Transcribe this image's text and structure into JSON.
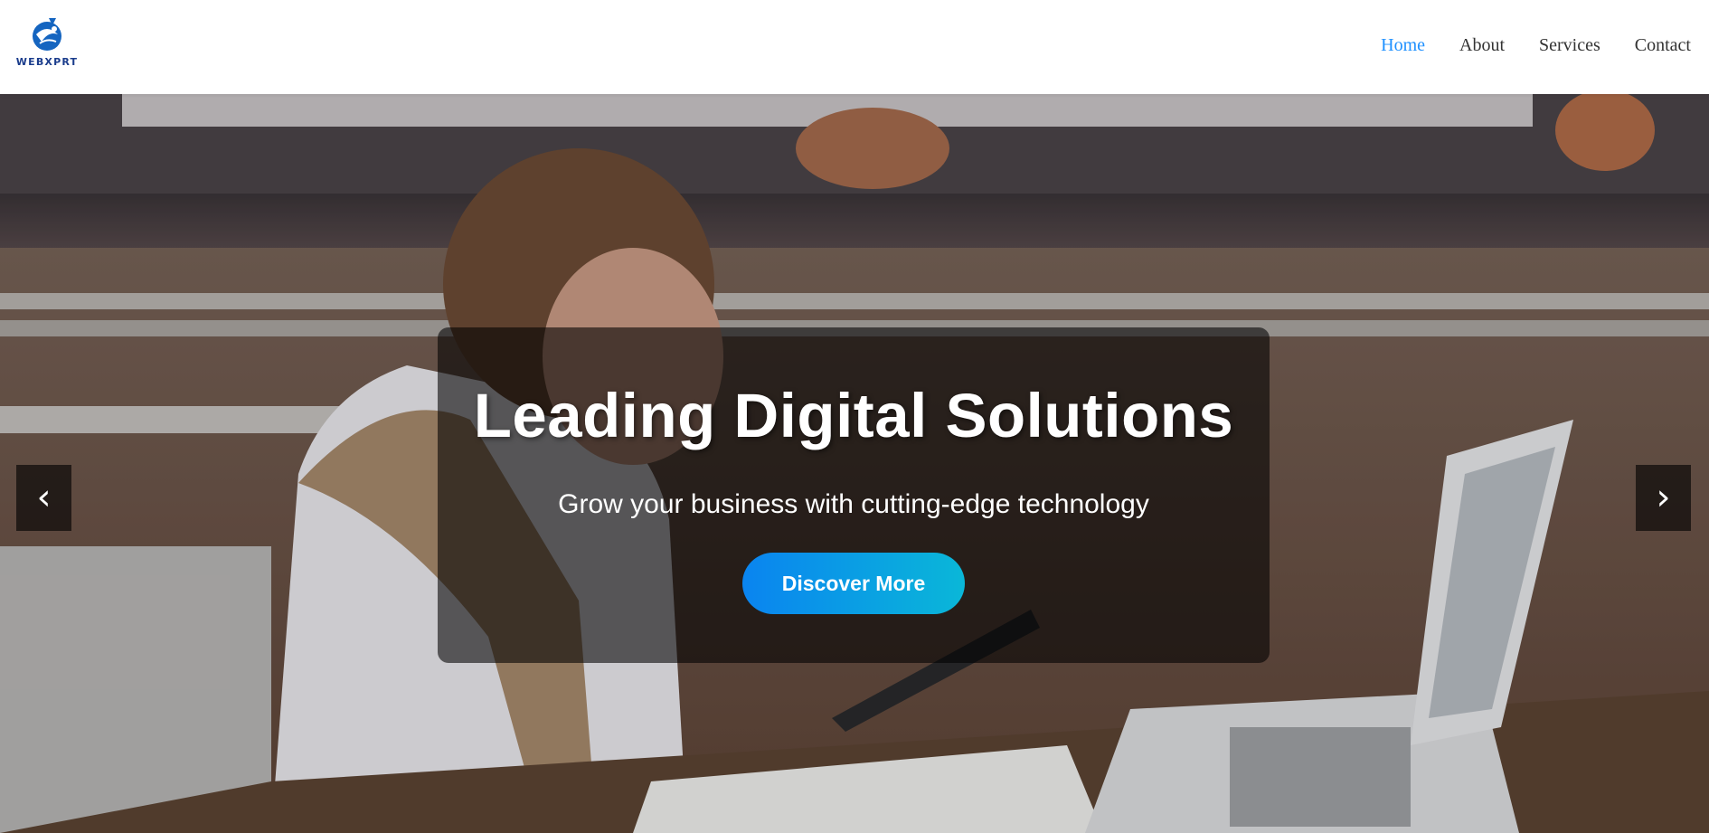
{
  "brand": {
    "logo_text": "WEBXPRT",
    "logo_icon": "globe-fish-icon"
  },
  "nav": {
    "items": [
      {
        "label": "Home",
        "active": true
      },
      {
        "label": "About",
        "active": false
      },
      {
        "label": "Services",
        "active": false
      },
      {
        "label": "Contact",
        "active": false
      }
    ],
    "active_color": "#1e90ff"
  },
  "hero": {
    "title": "Leading Digital Solutions",
    "subtitle": "Grow your business with cutting-edge technology",
    "cta_label": "Discover More",
    "prev_icon": "‹",
    "next_icon": "›",
    "cta_gradient": [
      "#0a84f0",
      "#0ab7d8"
    ]
  }
}
